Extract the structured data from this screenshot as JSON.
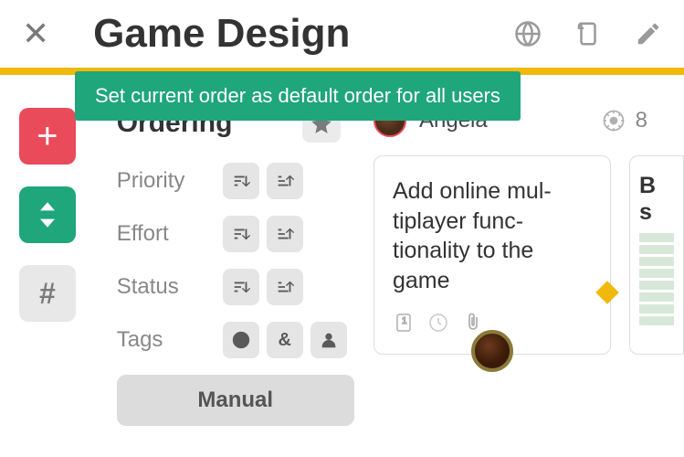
{
  "header": {
    "title": "Game Design"
  },
  "tooltip": "Set current order as default order for all users",
  "ordering": {
    "title": "Ordering",
    "rows": [
      {
        "label": "Priority"
      },
      {
        "label": "Effort"
      },
      {
        "label": "Status"
      },
      {
        "label": "Tags"
      }
    ],
    "manual": "Manual"
  },
  "person": {
    "name": "Angela",
    "count": "8"
  },
  "card1": {
    "title": "Add online mul­tiplayer func­tionality to the game"
  },
  "card2": {
    "title_part1": "B",
    "title_part2": "s"
  }
}
